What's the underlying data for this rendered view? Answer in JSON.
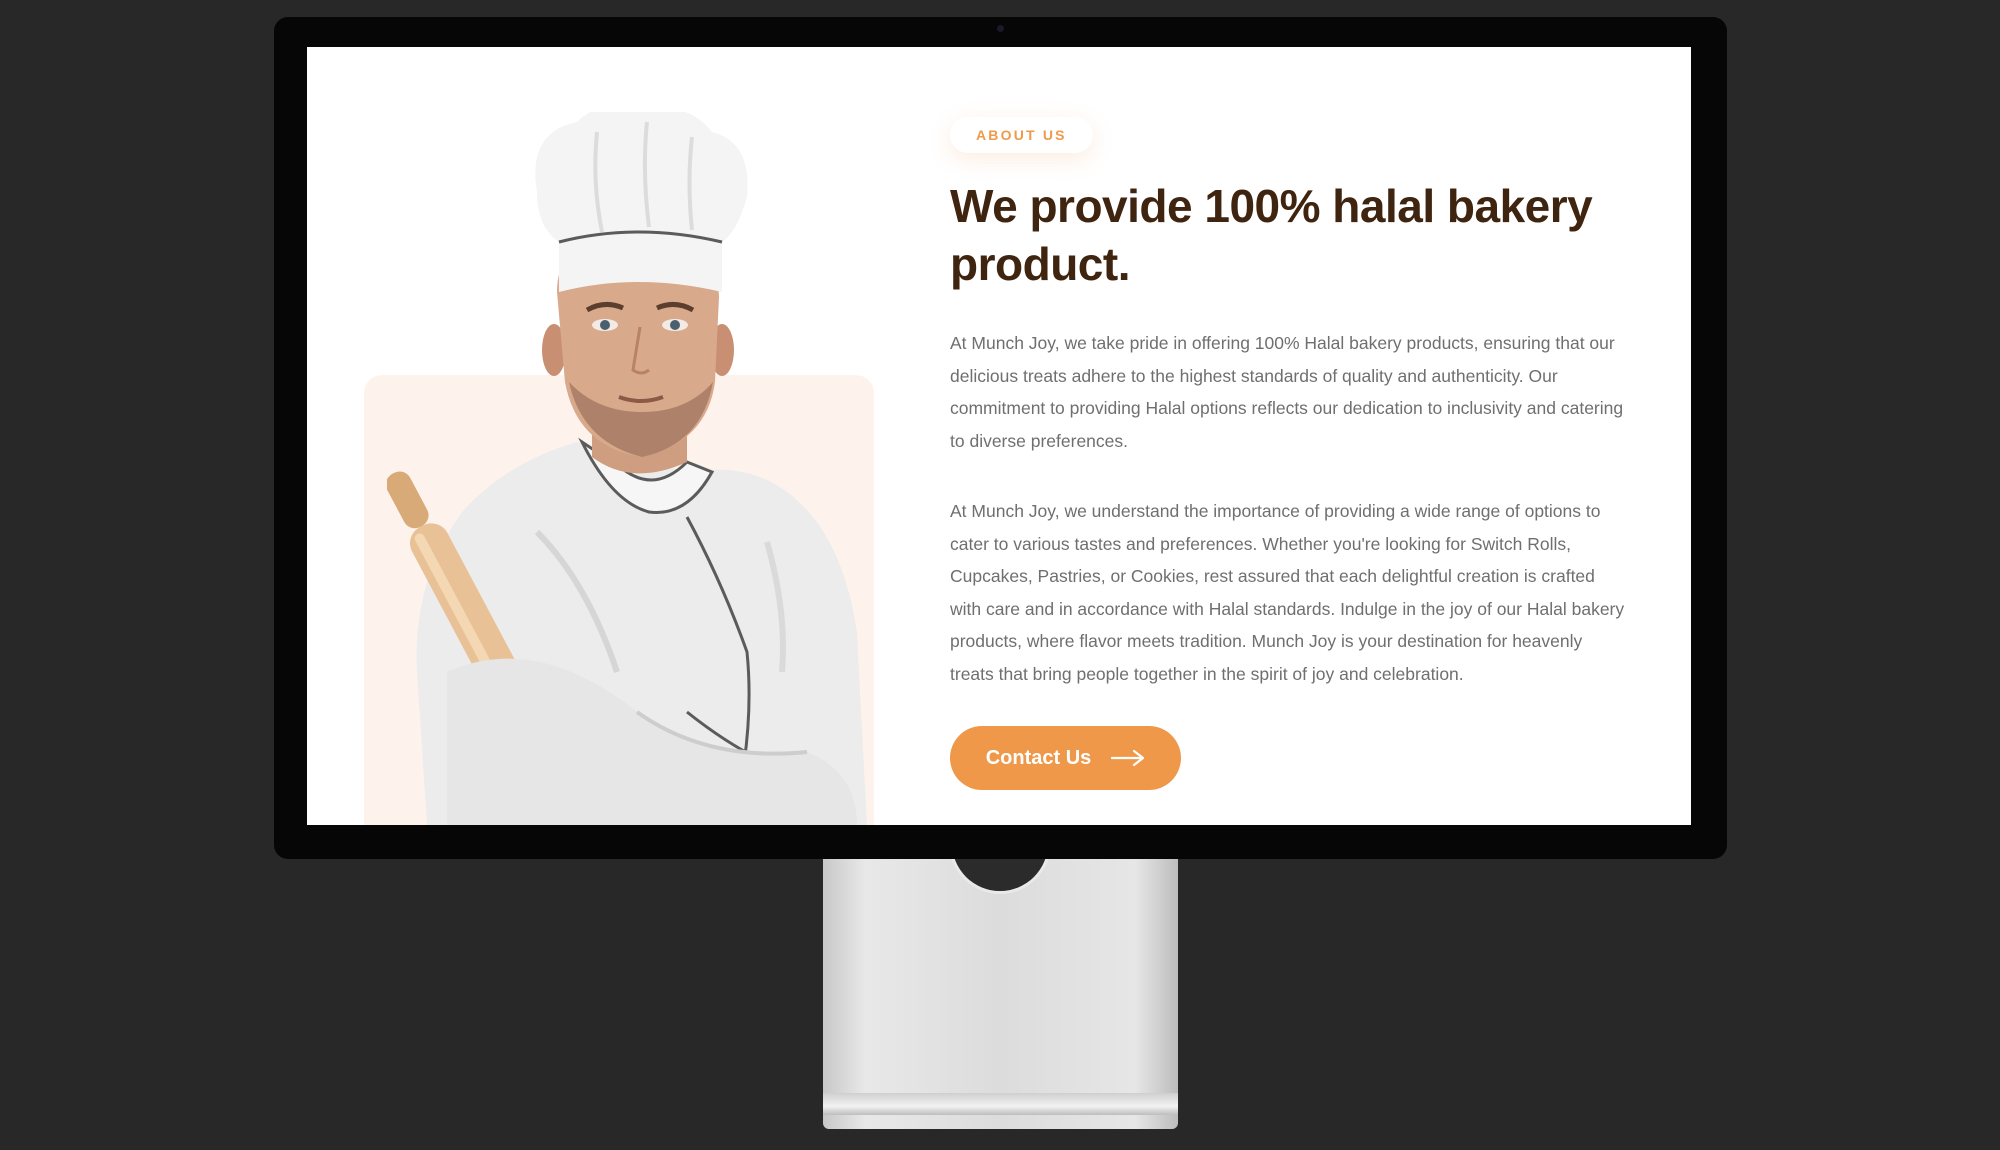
{
  "about": {
    "badge": "ABOUT US",
    "headline": "We provide 100% halal bakery product.",
    "paragraph_1": "At Munch Joy, we take pride in offering 100% Halal bakery products, ensuring that our delicious treats adhere to the highest standards of quality and authenticity. Our commitment to providing Halal options reflects our dedication to inclusivity and catering to diverse preferences.",
    "paragraph_2": "At Munch Joy, we understand the importance of providing a wide range of options to cater to various tastes and preferences. Whether you're looking for Switch Rolls, Cupcakes, Pastries, or Cookies, rest assured that each delightful creation is crafted with care and in accordance with Halal standards. Indulge in the joy of our Halal bakery products, where flavor meets tradition. Munch Joy is your destination for heavenly treats that bring people together in the spirit of joy and celebration.",
    "cta_label": "Contact Us",
    "cta_icon": "arrow-right-icon"
  },
  "colors": {
    "accent": "#f0984a",
    "heading": "#3f2410",
    "body_text": "#6f6f6f",
    "card_bg": "#fdf3ec",
    "page_bg": "#282828"
  }
}
